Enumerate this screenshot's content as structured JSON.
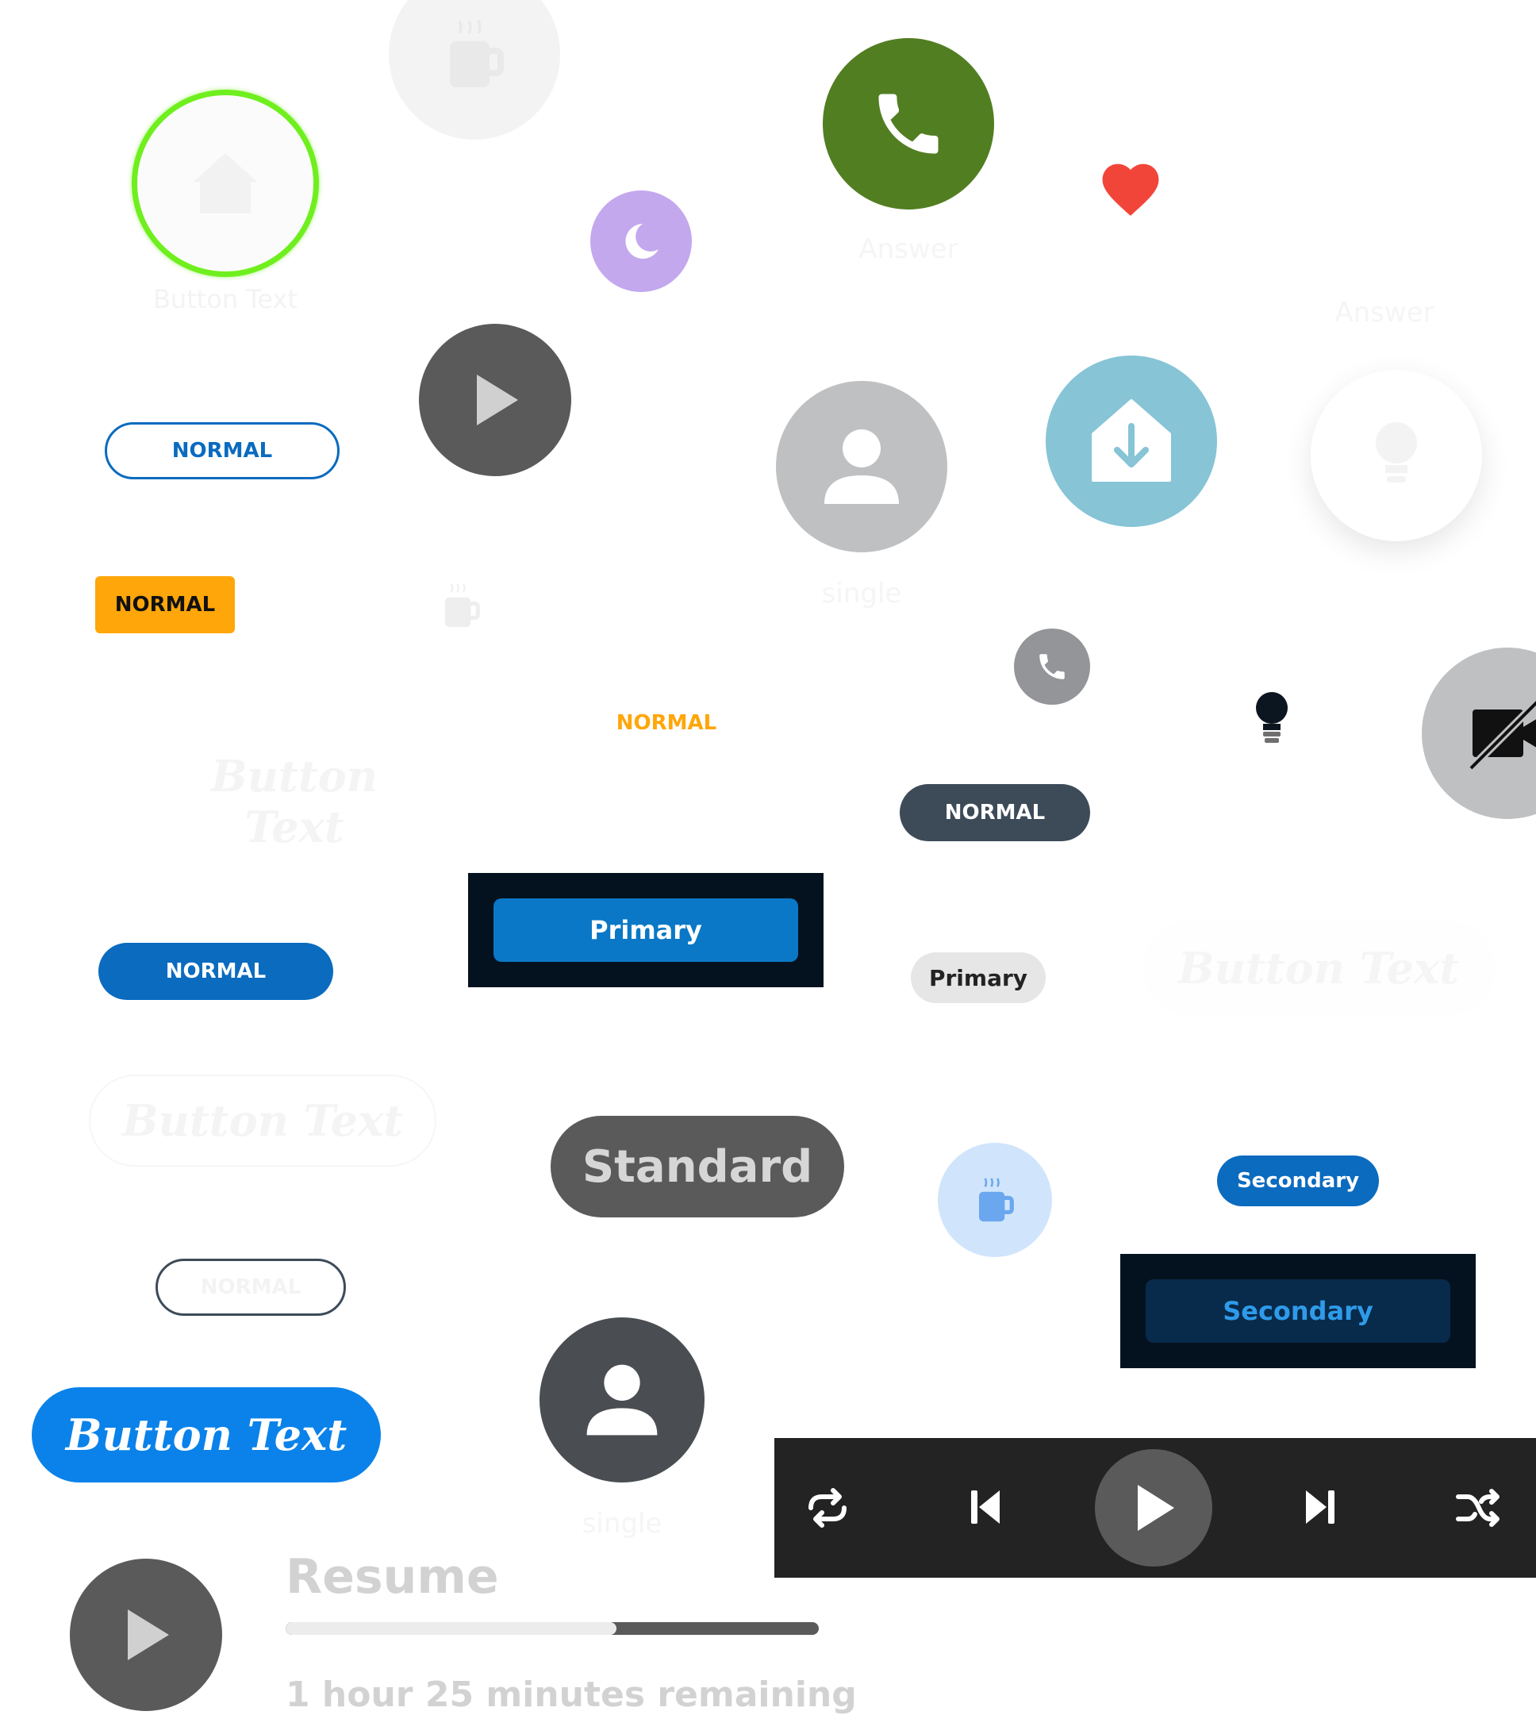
{
  "colors": {
    "green_ring": "#6fef1e",
    "answer_green": "#527e22",
    "heart_red": "#f2453a",
    "lavender": "#c3a8ee",
    "dark_gray": "#5a5a5a",
    "outline_blue": "#0a6bbf",
    "amber": "#ffa60a",
    "teal": "#86c4d6",
    "avatar_gray": "#bfc0c2",
    "slate": "#3d4b59",
    "primary_blue": "#0a78c6",
    "navy": "#04121f",
    "bright_blue": "#0a82ea",
    "light_blue_bg": "#d0e5fb",
    "player_bg": "#232323"
  },
  "ghost_labels": {
    "top_left": "Button Text",
    "answer_center": "Answer",
    "answer_right": "Answer",
    "avatar_single": "single",
    "avatar_single_bottom": "single",
    "faint_serif_1": "Button Text",
    "faint_serif_2": "Button Text",
    "faint_serif_3": "Button Text",
    "outline_normal": "NORMAL"
  },
  "buttons": {
    "normal_outline": "NORMAL",
    "normal_amber": "NORMAL",
    "normal_text_orange": "NORMAL",
    "normal_slate": "NORMAL",
    "normal_blue": "NORMAL",
    "primary_dark": "Primary",
    "primary_light": "Primary",
    "standard": "Standard",
    "secondary_pill": "Secondary",
    "secondary_dark": "Secondary",
    "button_text_big": "Button Text"
  },
  "icons": {
    "coffee_top": "coffee-mug-icon",
    "home_ring": "home-icon",
    "phone_answer": "phone-icon",
    "heart": "heart-icon",
    "moon": "moon-icon",
    "play": "play-icon",
    "avatar": "person-icon",
    "download_home": "home-download-icon",
    "lightbulb_faint": "lightbulb-icon",
    "coffee_small": "coffee-mug-icon",
    "phone_small": "phone-icon",
    "lightbulb_small": "lightbulb-icon",
    "video_off": "video-off-icon",
    "coffee_blue": "coffee-mug-icon"
  },
  "player": {
    "repeat": "repeat-icon",
    "previous": "skip-previous-icon",
    "play": "play-icon",
    "next": "skip-next-icon",
    "shuffle": "shuffle-icon"
  },
  "resume": {
    "title": "Resume",
    "remaining": "1 hour 25 minutes remaining",
    "progress_fraction": 0.62
  }
}
